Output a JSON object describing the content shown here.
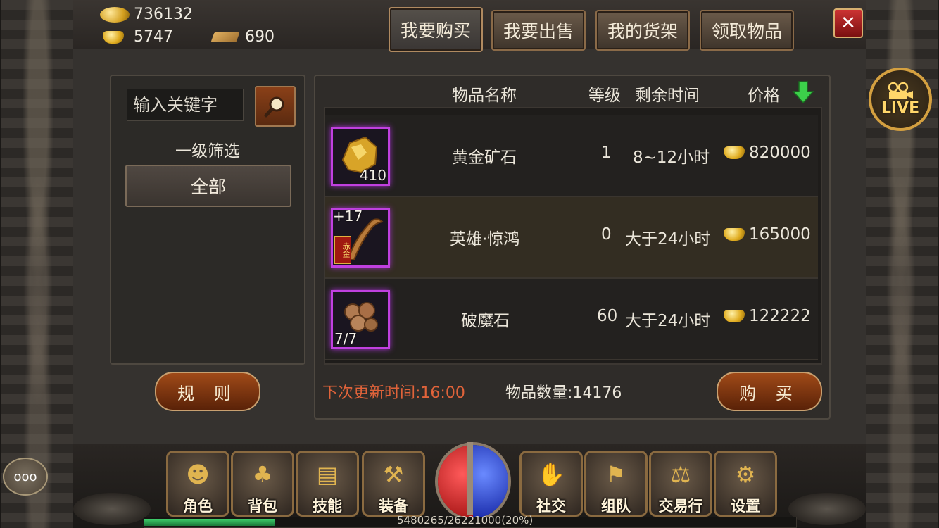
{
  "currency": {
    "silver": "736132",
    "gold_ingot": "5747",
    "ticket": "690"
  },
  "tabs": [
    {
      "label": "我要购买",
      "active": true
    },
    {
      "label": "我要出售",
      "active": false
    },
    {
      "label": "我的货架",
      "active": false
    },
    {
      "label": "领取物品",
      "active": false
    }
  ],
  "close_icon": "close-icon",
  "search": {
    "placeholder": "输入关键字"
  },
  "filter": {
    "title": "一级筛选",
    "all_label": "全部"
  },
  "rule_label": "规 则",
  "buy_label": "购 买",
  "table": {
    "headers": {
      "name": "物品名称",
      "level": "等级",
      "time": "剩余时间",
      "price": "价格"
    },
    "rows": [
      {
        "name": "黄金矿石",
        "level": "1",
        "time": "8~12小时",
        "price": "820000",
        "qty": "410",
        "icon": "gold-ore-icon"
      },
      {
        "name": "英雄·惊鸿",
        "level": "0",
        "time": "大于24小时",
        "price": "165000",
        "qty": "+17",
        "icon": "weapon-icon",
        "badge": "赤金"
      },
      {
        "name": "破魔石",
        "level": "60",
        "time": "大于24小时",
        "price": "122222",
        "qty": "7/7",
        "icon": "demon-stone-icon"
      }
    ]
  },
  "footer": {
    "next_update": "下次更新时间:16:00",
    "item_count": "物品数量:14176"
  },
  "live_label": "LIVE",
  "chat_label": "ooo",
  "menu": [
    {
      "label": "角色",
      "icon": "character-icon"
    },
    {
      "label": "背包",
      "icon": "bag-icon"
    },
    {
      "label": "技能",
      "icon": "skill-book-icon"
    },
    {
      "label": "装备",
      "icon": "equipment-icon"
    },
    {
      "label": "社交",
      "icon": "handshake-icon"
    },
    {
      "label": "组队",
      "icon": "team-flag-icon"
    },
    {
      "label": "交易行",
      "icon": "auction-hammer-icon"
    },
    {
      "label": "设置",
      "icon": "gear-icon"
    }
  ],
  "exp": {
    "text": "5480265/26221000(20%)",
    "fraction": 0.2
  },
  "colors": {
    "accent_red": "#e0633a",
    "rarity_purple": "#c040e0",
    "exp_green": "#3dcc6a"
  }
}
